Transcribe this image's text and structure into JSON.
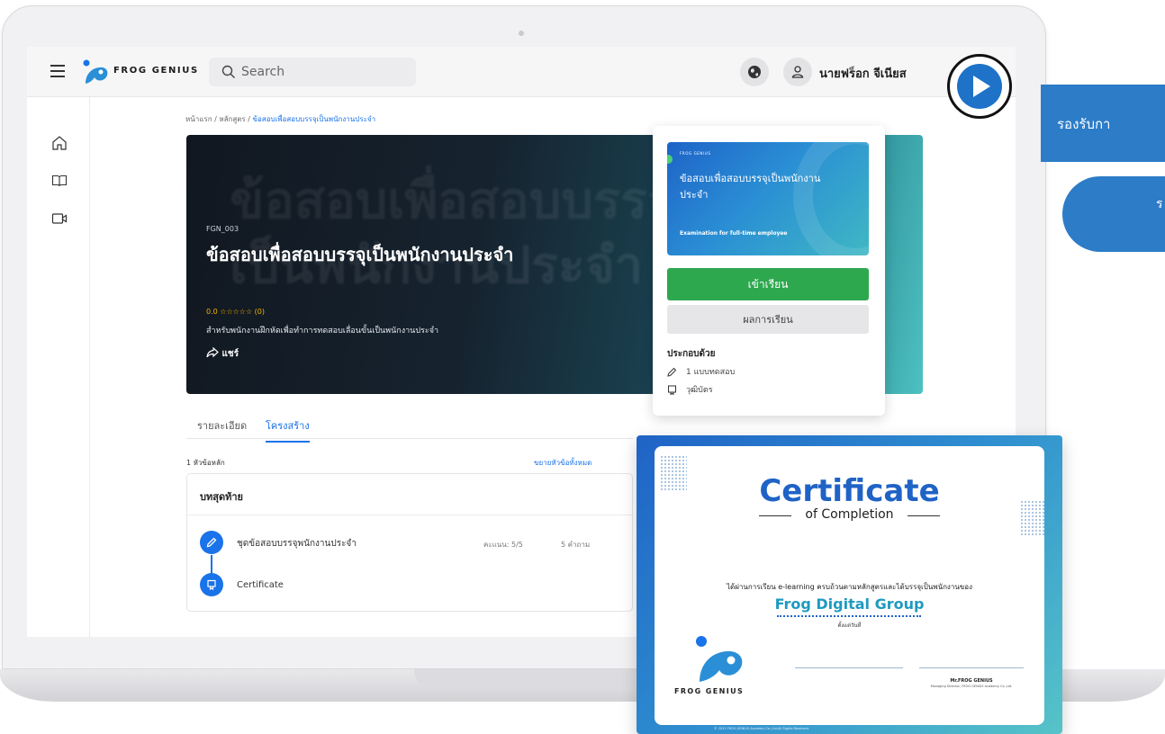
{
  "topbar": {
    "brand": "FROG GENIUS",
    "search_placeholder": "Search",
    "user_name": "นายฟร็อก จีเนียส"
  },
  "breadcrumb": {
    "items": [
      "หน้าแรก",
      "หลักสูตร"
    ],
    "current": "ข้อสอบเพื่อสอบบรรจุเป็นพนักงานประจำ"
  },
  "hero": {
    "background_text_1": "ข้อสอบเพื่อสอบบรรจุ",
    "background_text_2": "เป็นพนักงานประจำ",
    "course_code": "FGN_003",
    "title": "ข้อสอบเพื่อสอบบรรจุเป็นพนักงานประจำ",
    "rating": "0.0 ☆☆☆☆☆ (0)",
    "description": "สำหรับพนักงานฝึกหัดเพื่อทำการทดสอบเลื่อนขั้นเป็นพนักงานประจำ",
    "share_label": "แชร์"
  },
  "course_card": {
    "thumb_brand": "FROG GENIUS",
    "thumb_title": "ข้อสอบเพื่อสอบบรรจุเป็นพนักงานประจำ",
    "thumb_subtitle": "Examination for full-time employee",
    "enter_label": "เข้าเรียน",
    "result_label": "ผลการเรียน",
    "includes_title": "ประกอบด้วย",
    "includes": [
      "1 แบบทดสอบ",
      "วุฒิบัตร"
    ]
  },
  "tabs": {
    "items": [
      "รายละเอียด",
      "โครงสร้าง"
    ],
    "active": "โครงสร้าง"
  },
  "structure": {
    "topics_count": "1 หัวข้อหลัก",
    "expand_all": "ขยายหัวข้อทั้งหมด",
    "module_title": "บทสุดท้าย",
    "lessons": [
      {
        "label": "ชุดข้อสอบบรรจุพนักงานประจำ",
        "score": "คะแนน: 5/5",
        "questions": "5 คำถาม"
      },
      {
        "label": "Certificate"
      }
    ]
  },
  "marketing": {
    "banner_text": "รองรับกา",
    "pill_text": "ร"
  },
  "certificate": {
    "title": "Certificate",
    "subtitle": "of Completion",
    "body": "ได้ผ่านการเรียน e-learning ครบถ้วนตามหลักสูตรและได้บรรจุเป็นพนักงานของ",
    "organization": "Frog Digital Group",
    "date_label": "ตั้งแต่วันที่",
    "brand": "FROG GENIUS",
    "signer": "Mr.FROG GENIUS",
    "signer_role": "Managing Director, FROG GENIUS Academy Co.,Ltd.",
    "footer": "© 2022 FROG GENIUS Academy Co.,Ltd.All Rights Reserved."
  },
  "colors": {
    "primary": "#1a73e8",
    "enter_green": "#2ea84f",
    "marketing_blue": "#2c7cc8"
  }
}
